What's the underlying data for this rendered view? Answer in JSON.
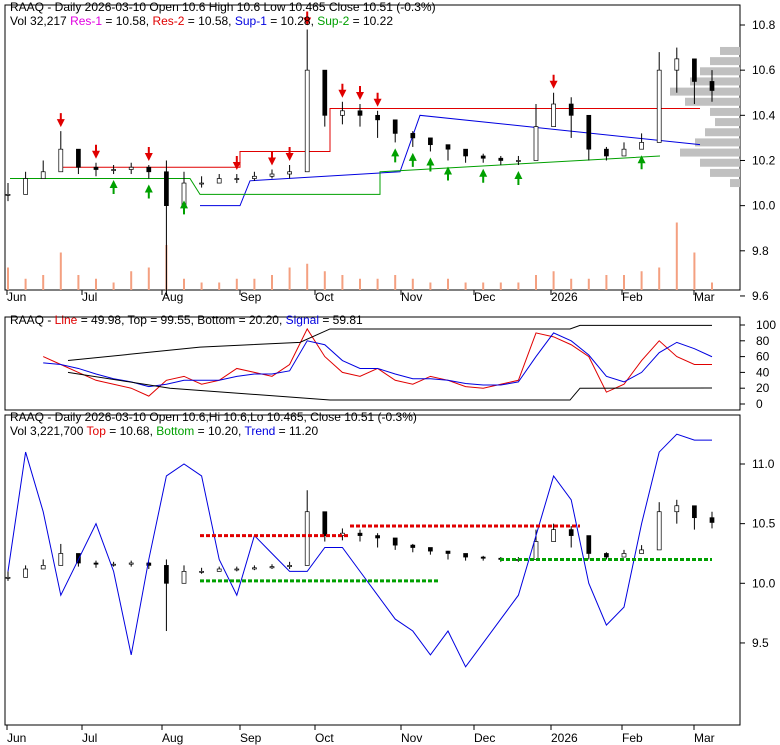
{
  "panel1": {
    "line1": {
      "ticker": "RAAQ",
      "text": "RAAQ - Daily 2026-03-10 Open 10.6  High 10.6  Low 10.465  Close 10.51 (-0.3%)"
    },
    "vol": "Vol 32,217",
    "res1_label": "Res-1",
    "res1": " = 10.58, ",
    "res2_label": "Res-2",
    "res2": " = 10.58, ",
    "sup1_label": "Sup-1",
    "sup1": " = 10.28, ",
    "sup2_label": "Sup-2",
    "sup2": " = 10.22"
  },
  "panel2": {
    "prefix": "RAAQ - ",
    "line_label": "Line",
    "line": " = 49.98, Top = 99.55, Bottom = 20.20, ",
    "signal_label": "Signal",
    "signal": " = 59.81"
  },
  "panel3": {
    "line1": "RAAQ - Daily 2026-03-10 Open 10.6,Hi 10.6,Lo 10.465, Close 10.51 (-0.3%)",
    "line2_a": "Vol 3,221,700 ",
    "top_label": "Top",
    "top": " = 10.68, ",
    "bottom_label": "Bottom",
    "bottom": " = 10.20, ",
    "trend_label": "Trend",
    "trend": " = 11.20"
  },
  "colors": {
    "res1": "#e000e0",
    "res2": "#e00000",
    "sup1": "#0000e0",
    "sup2": "#00a000",
    "volume": "#f4a080",
    "signal": "#0000e0",
    "line": "#e00000"
  },
  "chart_data": {
    "type": "line",
    "months": [
      "Jun",
      "Jul",
      "Aug",
      "Sep",
      "Oct",
      "Nov",
      "Dec",
      "2026",
      "Feb",
      "Mar"
    ],
    "price_axis1": {
      "ticks": [
        "10.8",
        "10.6",
        "10.4",
        "10.2",
        "10.0",
        "9.8",
        "9.6"
      ],
      "ylim": [
        9.6,
        10.8
      ]
    },
    "price_axis2": {
      "ticks": [
        "100",
        "80",
        "60",
        "40",
        "20",
        "0"
      ],
      "ylim": [
        0,
        100
      ]
    },
    "price_axis3": {
      "ticks": [
        "11.0",
        "10.5",
        "10.0",
        "9.5"
      ],
      "ylim": [
        9.32,
        11.32
      ]
    },
    "closes": [
      10.05,
      10.12,
      10.15,
      10.25,
      10.17,
      10.16,
      10.16,
      10.17,
      10.15,
      10.0,
      10.1,
      10.1,
      10.12,
      10.12,
      10.13,
      10.14,
      10.15,
      10.6,
      10.4,
      10.42,
      10.4,
      10.38,
      10.32,
      10.3,
      10.27,
      10.25,
      10.22,
      10.21,
      10.2,
      10.2,
      10.35,
      10.45,
      10.4,
      10.25,
      10.22,
      10.25,
      10.28,
      10.6,
      10.65,
      10.55,
      10.51
    ],
    "highs": [
      10.1,
      10.15,
      10.2,
      10.33,
      10.2,
      10.19,
      10.18,
      10.19,
      10.18,
      10.2,
      10.15,
      10.13,
      10.14,
      10.14,
      10.15,
      10.16,
      10.18,
      10.78,
      10.5,
      10.46,
      10.45,
      10.42,
      10.36,
      10.33,
      10.3,
      10.27,
      10.24,
      10.23,
      10.22,
      10.22,
      10.45,
      10.5,
      10.48,
      10.3,
      10.26,
      10.28,
      10.32,
      10.68,
      10.7,
      10.62,
      10.6
    ],
    "lows": [
      10.02,
      10.08,
      10.12,
      10.15,
      10.14,
      10.13,
      10.14,
      10.14,
      10.12,
      9.6,
      10.05,
      10.08,
      10.1,
      10.1,
      10.11,
      10.12,
      10.12,
      10.15,
      10.35,
      10.36,
      10.35,
      10.3,
      10.28,
      10.26,
      10.24,
      10.2,
      10.19,
      10.19,
      10.18,
      10.18,
      10.2,
      10.35,
      10.3,
      10.2,
      10.2,
      10.22,
      10.25,
      10.3,
      10.5,
      10.45,
      10.46
    ],
    "volume": [
      0.3,
      0.15,
      0.2,
      0.5,
      0.2,
      0.15,
      0.1,
      0.25,
      0.3,
      0.6,
      0.15,
      0.1,
      0.1,
      0.15,
      0.15,
      0.2,
      0.3,
      0.35,
      0.25,
      0.2,
      0.15,
      0.15,
      0.2,
      0.15,
      0.1,
      0.15,
      0.1,
      0.1,
      0.1,
      0.1,
      0.2,
      0.25,
      0.15,
      0.15,
      0.2,
      0.2,
      0.25,
      0.3,
      0.9,
      0.5,
      0.1
    ],
    "line": [
      55,
      45,
      60,
      50,
      40,
      30,
      25,
      20,
      10,
      30,
      35,
      25,
      30,
      45,
      40,
      35,
      50,
      95,
      60,
      40,
      35,
      45,
      30,
      25,
      35,
      30,
      22,
      20,
      25,
      30,
      90,
      85,
      75,
      60,
      15,
      25,
      55,
      80,
      60,
      50,
      49.98
    ],
    "signal": [
      55,
      50,
      52,
      50,
      45,
      38,
      32,
      28,
      22,
      25,
      30,
      30,
      30,
      35,
      38,
      38,
      42,
      80,
      75,
      55,
      45,
      45,
      38,
      32,
      32,
      30,
      26,
      24,
      24,
      28,
      60,
      90,
      80,
      62,
      35,
      28,
      40,
      65,
      78,
      70,
      59.81
    ],
    "trend": [
      10.1,
      11.1,
      10.6,
      9.9,
      10.2,
      10.5,
      10.1,
      9.4,
      10.2,
      10.9,
      11.0,
      10.9,
      10.2,
      9.9,
      10.4,
      10.25,
      10.1,
      10.1,
      10.3,
      10.3,
      10.1,
      9.9,
      9.7,
      9.6,
      9.4,
      9.6,
      9.3,
      9.5,
      9.7,
      9.9,
      10.4,
      10.9,
      10.7,
      10.0,
      9.65,
      9.8,
      10.5,
      11.1,
      11.25,
      11.2,
      11.2
    ],
    "sell_signal_idx": [
      3,
      5,
      8,
      13,
      15,
      16,
      17,
      19,
      20,
      21,
      31
    ],
    "buy_signal_idx": [
      6,
      8,
      10,
      22,
      23,
      24,
      25,
      27,
      29,
      36
    ]
  }
}
